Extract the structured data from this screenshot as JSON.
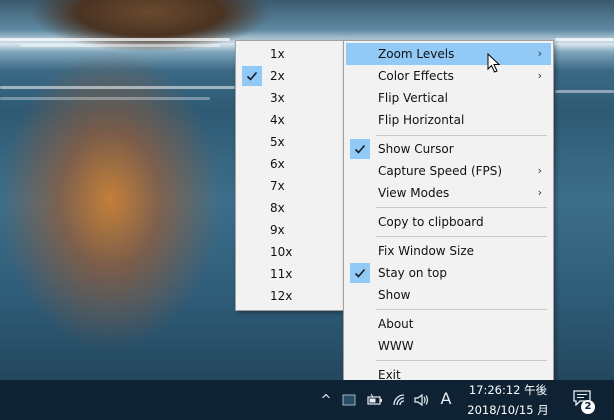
{
  "zoom_submenu": {
    "items": [
      {
        "label": "1x",
        "checked": false
      },
      {
        "label": "2x",
        "checked": true
      },
      {
        "label": "3x",
        "checked": false
      },
      {
        "label": "4x",
        "checked": false
      },
      {
        "label": "5x",
        "checked": false
      },
      {
        "label": "6x",
        "checked": false
      },
      {
        "label": "7x",
        "checked": false
      },
      {
        "label": "8x",
        "checked": false
      },
      {
        "label": "9x",
        "checked": false
      },
      {
        "label": "10x",
        "checked": false
      },
      {
        "label": "11x",
        "checked": false
      },
      {
        "label": "12x",
        "checked": false
      }
    ]
  },
  "main_menu": {
    "zoom_levels": "Zoom Levels",
    "color_effects": "Color Effects",
    "flip_vertical": "Flip Vertical",
    "flip_horizontal": "Flip Horizontal",
    "show_cursor": "Show Cursor",
    "capture_speed": "Capture Speed (FPS)",
    "view_modes": "View Modes",
    "copy_clipboard": "Copy to clipboard",
    "fix_window_size": "Fix Window Size",
    "stay_on_top": "Stay on top",
    "show": "Show",
    "about": "About",
    "www": "WWW",
    "exit": "Exit",
    "submenu_arrow": "›",
    "show_cursor_checked": true,
    "stay_on_top_checked": true
  },
  "taskbar": {
    "chevron": "^",
    "ime_label": "A",
    "time": "17:26:12 午後",
    "date": "2018/10/15 月",
    "notification_count": "2"
  },
  "colors": {
    "highlight": "#91c9f7",
    "menu_bg": "#f2f2f2",
    "taskbar_bg": "#0e2233"
  }
}
